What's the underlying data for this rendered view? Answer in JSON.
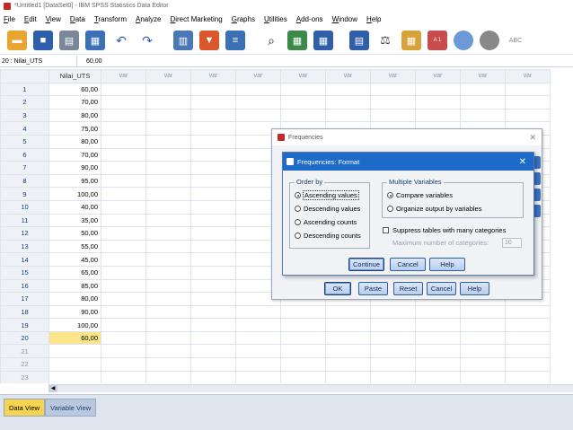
{
  "window": {
    "title": "*Untitled1 [DataSet0] - IBM SPSS Statistics Data Editor"
  },
  "menubar": [
    "File",
    "Edit",
    "View",
    "Data",
    "Transform",
    "Analyze",
    "Direct Marketing",
    "Graphs",
    "Utilities",
    "Add-ons",
    "Window",
    "Help"
  ],
  "toolbar": {
    "icons": [
      "open-folder-icon",
      "save-icon",
      "print-icon",
      "dialog-recall-icon",
      "undo-icon",
      "redo-icon",
      "goto-case-icon",
      "goto-variable-icon",
      "variables-icon",
      "find-icon",
      "insert-cases-icon",
      "insert-variable-icon",
      "split-file-icon",
      "weight-cases-icon",
      "select-cases-icon",
      "value-labels-icon",
      "use-sets-icon",
      "show-all-variables-icon",
      "spelling-icon"
    ],
    "value_labels_text": "A 1",
    "spelling_text": "ABC"
  },
  "cell_editor": {
    "reference": "20 : Nilai_UTS",
    "value": "60,00"
  },
  "grid": {
    "column_header": "Nilai_UTS",
    "var_label": "var",
    "rows": [
      {
        "n": "1",
        "v": "60,00"
      },
      {
        "n": "2",
        "v": "70,00"
      },
      {
        "n": "3",
        "v": "80,00"
      },
      {
        "n": "4",
        "v": "75,00"
      },
      {
        "n": "5",
        "v": "80,00"
      },
      {
        "n": "6",
        "v": "70,00"
      },
      {
        "n": "7",
        "v": "90,00"
      },
      {
        "n": "8",
        "v": "95,00"
      },
      {
        "n": "9",
        "v": "100,00"
      },
      {
        "n": "10",
        "v": "40,00"
      },
      {
        "n": "11",
        "v": "35,00"
      },
      {
        "n": "12",
        "v": "50,00"
      },
      {
        "n": "13",
        "v": "55,00"
      },
      {
        "n": "14",
        "v": "45,00"
      },
      {
        "n": "15",
        "v": "65,00"
      },
      {
        "n": "16",
        "v": "85,00"
      },
      {
        "n": "17",
        "v": "80,00"
      },
      {
        "n": "18",
        "v": "90,00"
      },
      {
        "n": "19",
        "v": "100,00"
      },
      {
        "n": "20",
        "v": "60,00"
      },
      {
        "n": "21",
        "v": ""
      },
      {
        "n": "22",
        "v": ""
      },
      {
        "n": "23",
        "v": ""
      }
    ]
  },
  "tabs": {
    "data_view": "Data View",
    "variable_view": "Variable View"
  },
  "frequencies_dialog": {
    "title": "Frequencies",
    "buttons": {
      "ok": "OK",
      "paste": "Paste",
      "reset": "Reset",
      "cancel": "Cancel",
      "help": "Help"
    }
  },
  "format_dialog": {
    "title": "Frequencies: Format",
    "order_by": {
      "legend": "Order by",
      "options": [
        "Ascending values",
        "Descending values",
        "Ascending counts",
        "Descending counts"
      ],
      "selected": "Ascending values"
    },
    "multiple_variables": {
      "legend": "Multiple Variables",
      "options": [
        "Compare variables",
        "Organize output by variables"
      ],
      "selected": "Compare variables"
    },
    "suppress_label": "Suppress tables with many categories",
    "max_categories_label": "Maximum number of categories:",
    "max_categories_value": "10",
    "buttons": {
      "continue": "Continue",
      "cancel": "Cancel",
      "help": "Help"
    }
  }
}
